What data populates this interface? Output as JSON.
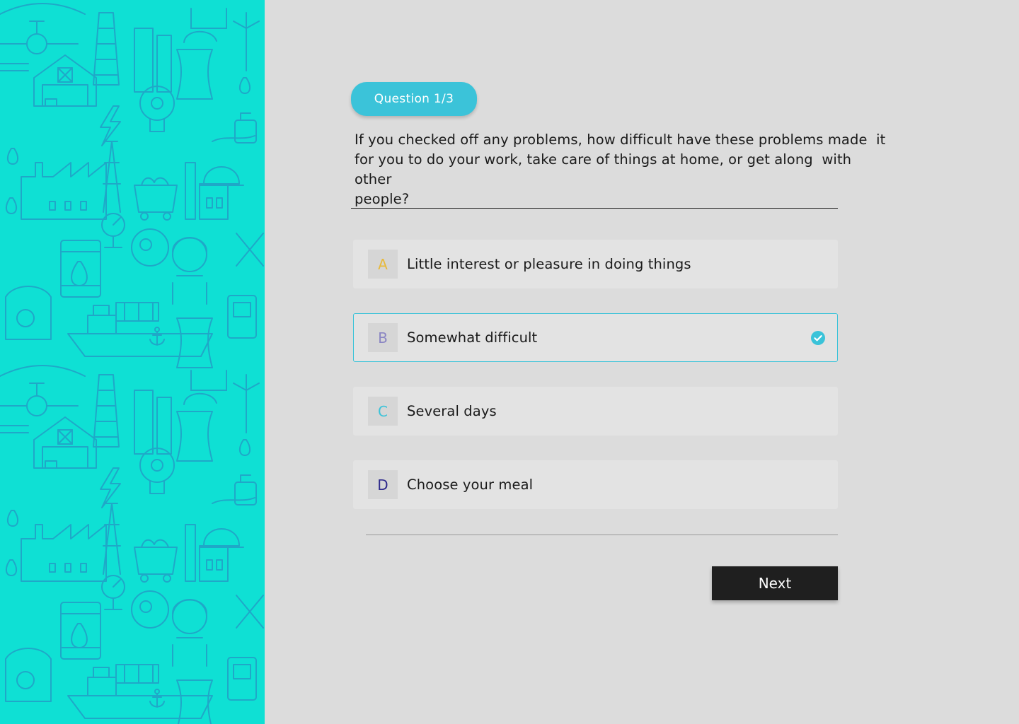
{
  "colors": {
    "side_panel_bg": "#0fe0d4",
    "pattern_stroke": "#1fa8c8",
    "accent": "#3bc3d9",
    "main_bg": "#dcdcdc",
    "option_bg": "#e3e3e3",
    "button_bg": "#1f1f1f"
  },
  "side_panel": {
    "pattern_icons": [
      "barn-icon",
      "factory-icon",
      "oil-drop-icon",
      "lightbulb-icon",
      "worker-icon",
      "ship-icon",
      "anchor-icon",
      "wind-turbine-icon",
      "truck-cart-icon",
      "pipeline-icon",
      "gauge-icon",
      "cooling-tower-icon"
    ]
  },
  "quiz": {
    "badge": "Question 1/3",
    "question": "If you checked off any problems, how difficult have these problems made  it\nfor you to do your work, take care of things at home, or get along  with other\npeople?",
    "options": [
      {
        "letter": "A",
        "label": "Little interest or pleasure in doing things",
        "letter_color": "#e8b93a",
        "selected": false
      },
      {
        "letter": "B",
        "label": "Somewhat difficult",
        "letter_color": "#8b86c3",
        "selected": true
      },
      {
        "letter": "C",
        "label": "Several days",
        "letter_color": "#3bc3d9",
        "selected": false
      },
      {
        "letter": "D",
        "label": "Choose your meal",
        "letter_color": "#2f2a8c",
        "selected": false
      }
    ],
    "next_label": "Next"
  }
}
